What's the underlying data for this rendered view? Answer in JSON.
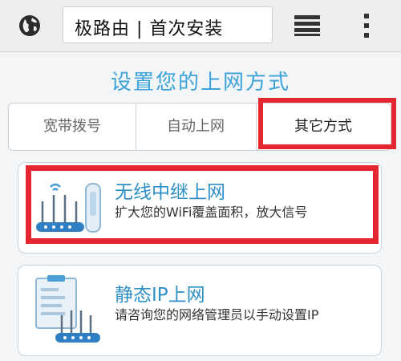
{
  "browser": {
    "url_text": "极路由 | 首次安装",
    "icons": {
      "site": "globe-icon",
      "tabs": "tabs-icon",
      "menu": "overflow-menu-icon"
    }
  },
  "page": {
    "title": "设置您的上网方式",
    "tabs": [
      {
        "label": "宽带拨号",
        "selected": false
      },
      {
        "label": "自动上网",
        "selected": false
      },
      {
        "label": "其它方式",
        "selected": true,
        "highlighted": true
      }
    ],
    "options": [
      {
        "title": "无线中继上网",
        "description": "扩大您的WiFi覆盖面积，放大信号",
        "icon": "router-repeater-icon",
        "highlighted": true
      },
      {
        "title": "静态IP上网",
        "description": "请咨询您的网络管理员以手动设置IP",
        "icon": "router-clipboard-icon",
        "highlighted": false
      }
    ]
  },
  "colors": {
    "accent": "#3ba3d9",
    "highlight": "#e3262f",
    "toolbar_bg": "#eeeeee"
  }
}
